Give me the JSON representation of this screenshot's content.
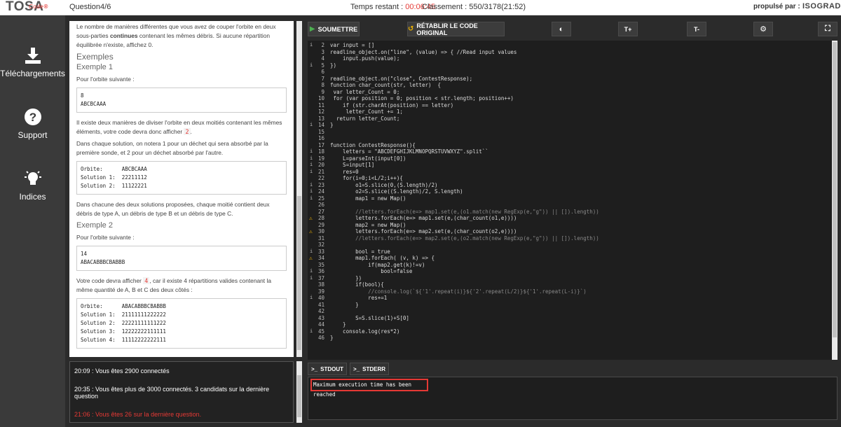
{
  "header": {
    "logo_text": "TOSA",
    "logo_sub": "Code",
    "question": "Question4/6",
    "timer_label": "Temps restant :",
    "timer_value": "00:06:45",
    "ranking": "Classement : 550/3178(21:52)",
    "powered_by": "propulsé par :",
    "brand": "ISOGRAD"
  },
  "sidebar": {
    "items": [
      {
        "label": "Téléchargements",
        "icon": "download-icon"
      },
      {
        "label": "Support",
        "icon": "help-icon"
      },
      {
        "label": "Indices",
        "icon": "lightbulb-icon"
      }
    ]
  },
  "problem": {
    "intro": "Le nombre de manières différentes que vous avez de couper l'orbite en deux sous-parties",
    "intro_bold": "continues",
    "intro_end": "contenant les mêmes débris. Si aucune répartition équilibrée n'existe, affichez 0.",
    "examples_title": "Exemples",
    "ex1_title": "Exemple 1",
    "ex1_input_label": "Pour l'orbite suivante :",
    "ex1_input": "8\nABCBCAAA",
    "ex1_text1": "Il existe deux manières de diviser l'orbite en deux moitiés contenant les mêmes éléments, votre code devra donc afficher",
    "ex1_answer": "2",
    "ex1_text2": "Dans chaque solution, on notera 1 pour un déchet qui sera absorbé par la première sonde, et 2 pour un déchet absorbé par l'autre.",
    "ex1_solutions": "Orbite:      ABCBCAAA\nSolution 1:  22211112\nSolution 2:  11122221",
    "ex1_text3": "Dans chacune des deux solutions proposées, chaque moitié contient deux débris de type A, un débris de type B et un débris de type C.",
    "ex2_title": "Exemple 2",
    "ex2_input_label": "Pour l'orbite suivante :",
    "ex2_input": "14\nABACABBBCBABBB",
    "ex2_text1": "Votre code devra afficher",
    "ex2_answer": "4",
    "ex2_text2": ", car il existe 4 répartitions valides contenant la même quantité de A, B et C des deux côtés :",
    "ex2_solutions": "Orbite:      ABACABBBCBABBB\nSolution 1:  21111111222222\nSolution 2:  22221111111222\nSolution 3:  12222222111111\nSolution 4:  11112222222111"
  },
  "chat": {
    "messages": [
      "20:09 : Vous êtes 2900 connectés",
      "20:35 : Vous êtes plus de 3000 connectés. 3 candidats sur la dernière question",
      "21:06 : Vous êtes 26 sur la dernière question."
    ]
  },
  "toolbar": {
    "submit": "SOUMETTRE",
    "reset": "RÉTABLIR LE CODE ORIGINAL",
    "font_up": "T+",
    "font_down": "T-"
  },
  "editor": {
    "lines": [
      {
        "n": "2",
        "fold": true,
        "code": "var input = []"
      },
      {
        "n": "3",
        "fold": false,
        "code": "readline_object.on(\"line\", (value) => { //Read input values"
      },
      {
        "n": "4",
        "fold": false,
        "code": "    input.push(value);"
      },
      {
        "n": "5",
        "fold": true,
        "code": "})"
      },
      {
        "n": "6",
        "fold": false,
        "code": ""
      },
      {
        "n": "7",
        "fold": false,
        "code": "readline_object.on(\"close\", ContestResponse);"
      },
      {
        "n": "8",
        "fold": false,
        "code": "function char_count(str, letter)  {"
      },
      {
        "n": "9",
        "fold": false,
        "code": " var letter_Count = 0;"
      },
      {
        "n": "10",
        "fold": false,
        "code": " for (var position = 0; position < str.length; position++)"
      },
      {
        "n": "11",
        "fold": false,
        "code": "    if (str.charAt(position) == letter)"
      },
      {
        "n": "12",
        "fold": false,
        "code": "     letter_Count += 1;"
      },
      {
        "n": "13",
        "fold": false,
        "code": "  return letter_Count;"
      },
      {
        "n": "14",
        "fold": true,
        "code": "}"
      },
      {
        "n": "15",
        "fold": false,
        "code": ""
      },
      {
        "n": "16",
        "fold": false,
        "code": ""
      },
      {
        "n": "17",
        "fold": false,
        "code": "function ContestResponse(){"
      },
      {
        "n": "18",
        "fold": true,
        "code": "    letters = \"ABCDEFGHIJKLMNOPQRSTUVWXYZ\".split``"
      },
      {
        "n": "19",
        "fold": true,
        "code": "    L=parseInt(input[0])"
      },
      {
        "n": "20",
        "fold": true,
        "code": "    S=input[1]"
      },
      {
        "n": "21",
        "fold": true,
        "code": "    res=0"
      },
      {
        "n": "22",
        "fold": false,
        "code": "    for(i=0;i<L/2;i++){"
      },
      {
        "n": "23",
        "fold": true,
        "code": "        o1=S.slice(0,(S.length)/2)"
      },
      {
        "n": "24",
        "fold": true,
        "code": "        o2=S.slice((S.length)/2, S.length)"
      },
      {
        "n": "25",
        "fold": true,
        "code": "        map1 = new Map()"
      },
      {
        "n": "26",
        "fold": false,
        "code": ""
      },
      {
        "n": "27",
        "fold": false,
        "code": "        //letters.forEach(e=> map1.set(e,(o1.match(new RegExp(e,\"g\")) || []).length))"
      },
      {
        "n": "28",
        "warn": true,
        "code": "        letters.forEach(e=> map1.set(e,(char_count(o1,e))))"
      },
      {
        "n": "29",
        "fold": false,
        "code": "        map2 = new Map()"
      },
      {
        "n": "30",
        "warn": true,
        "code": "        letters.forEach(e=> map2.set(e,(char_count(o2,e))))"
      },
      {
        "n": "31",
        "fold": false,
        "code": "        //letters.forEach(e=> map2.set(e,(o2.match(new RegExp(e,\"g\")) || []).length))"
      },
      {
        "n": "32",
        "fold": false,
        "code": ""
      },
      {
        "n": "33",
        "fold": true,
        "code": "        bool = true"
      },
      {
        "n": "34",
        "warn": true,
        "code": "        map1.forEach( (v, k) => {"
      },
      {
        "n": "35",
        "fold": false,
        "code": "            if(map2.get(k)!=v)"
      },
      {
        "n": "36",
        "fold": true,
        "code": "                bool=false"
      },
      {
        "n": "37",
        "fold": true,
        "code": "        })"
      },
      {
        "n": "38",
        "fold": false,
        "code": "        if(bool){"
      },
      {
        "n": "39",
        "fold": false,
        "code": "            //console.log(`${'1'.repeat(i)}${'2'.repeat(L/2)}${'1'.repeat(L-i)}`)"
      },
      {
        "n": "40",
        "fold": true,
        "code": "            res+=1"
      },
      {
        "n": "41",
        "fold": false,
        "code": "        }"
      },
      {
        "n": "42",
        "fold": false,
        "code": ""
      },
      {
        "n": "43",
        "fold": false,
        "code": "        S=S.slice(1)+S[0]"
      },
      {
        "n": "44",
        "fold": false,
        "code": "    }"
      },
      {
        "n": "45",
        "fold": true,
        "code": "    console.log(res*2)"
      },
      {
        "n": "46",
        "fold": false,
        "code": "}"
      }
    ]
  },
  "tabs": {
    "stdout": "STDOUT",
    "stderr": "STDERR"
  },
  "output": {
    "error": "Maximum execution time has been reached"
  },
  "colors": {
    "accent_red": "#e53935",
    "submit_green": "#4caf50"
  }
}
